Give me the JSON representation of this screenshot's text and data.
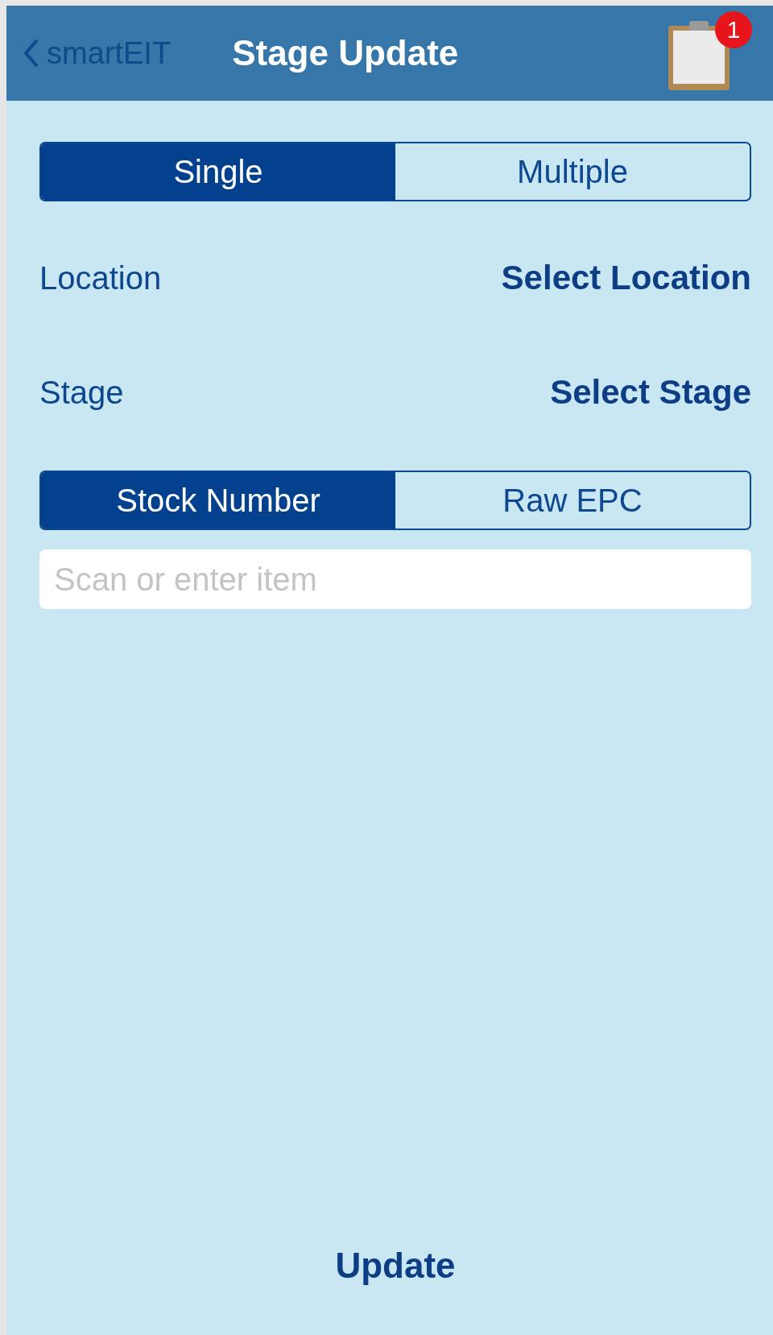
{
  "nav_bar": {
    "back_label": "smartEIT",
    "title": "Stage Update",
    "badge": "1"
  },
  "mode_tabs": [
    {
      "label": "Single",
      "selected": true
    },
    {
      "label": "Multiple",
      "selected": false
    }
  ],
  "fields": [
    {
      "label": "Location",
      "value": "Select Location"
    },
    {
      "label": "Stage",
      "value": "Select Stage"
    }
  ],
  "id_type_tabs": [
    {
      "label": "Stock Number",
      "selected": true
    },
    {
      "label": "Raw EPC",
      "selected": false
    }
  ],
  "item_input": {
    "placeholder": "Scan or enter item"
  },
  "update_button": {
    "label": "Update"
  }
}
